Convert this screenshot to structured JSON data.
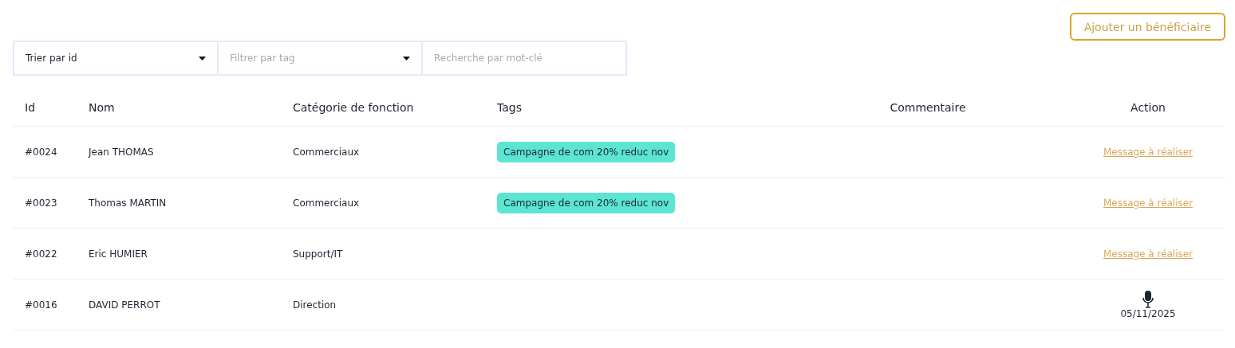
{
  "add_button": {
    "label": "Ajouter un bénéficiaire"
  },
  "filters": {
    "sort": {
      "value": "Trier par id"
    },
    "tag": {
      "placeholder": "Filtrer par tag"
    },
    "search": {
      "placeholder": "Recherche par mot-clé"
    }
  },
  "table": {
    "columns": [
      "Id",
      "Nom",
      "Catégorie de fonction",
      "Tags",
      "Commentaire",
      "Action"
    ],
    "rows": [
      {
        "id": "#0024",
        "name": "Jean THOMAS",
        "category": "Commerciaux",
        "tags": [
          "Campagne de com 20% reduc nov"
        ],
        "action": {
          "kind": "link",
          "label": "Message à réaliser"
        }
      },
      {
        "id": "#0023",
        "name": "Thomas MARTIN",
        "category": "Commerciaux",
        "tags": [
          "Campagne de com 20% reduc nov"
        ],
        "action": {
          "kind": "link",
          "label": "Message à réaliser"
        }
      },
      {
        "id": "#0022",
        "name": "Eric HUMIER",
        "category": "Support/IT",
        "action": {
          "kind": "link",
          "label": "Message à réaliser"
        }
      },
      {
        "id": "#0016",
        "name": "DAVID PERROT",
        "category": "Direction",
        "action": {
          "kind": "recording",
          "date": "05/11/2025"
        }
      }
    ]
  }
}
